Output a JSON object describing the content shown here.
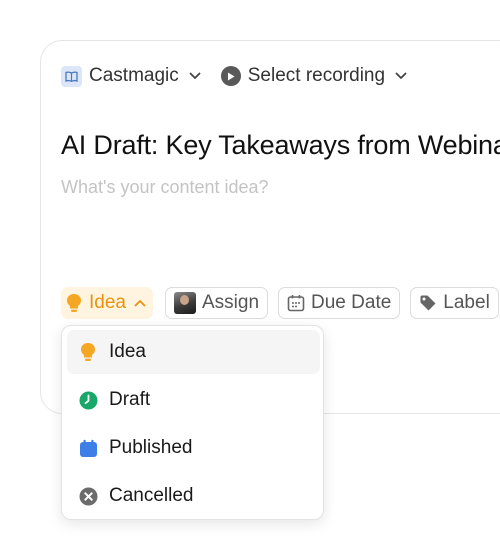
{
  "header": {
    "workspace_label": "Castmagic",
    "recording_label": "Select recording"
  },
  "editor": {
    "title": "AI Draft: Key Takeaways from Webina",
    "placeholder": "What's your content idea?"
  },
  "chips": {
    "status_label": "Idea",
    "assign_label": "Assign",
    "due_date_label": "Due Date",
    "label_label": "Label"
  },
  "status_menu": {
    "items": [
      {
        "label": "Idea",
        "icon": "bulb-icon",
        "color": "#f5a623"
      },
      {
        "label": "Draft",
        "icon": "clock-icon",
        "color": "#1aa86a"
      },
      {
        "label": "Published",
        "icon": "calendar-icon",
        "color": "#3d7fe6"
      },
      {
        "label": "Cancelled",
        "icon": "cancel-icon",
        "color": "#6b6b6b"
      }
    ],
    "selected": "Idea"
  },
  "colors": {
    "idea": "#f5a623",
    "idea_bg": "#fff4e0",
    "draft": "#1aa86a",
    "published": "#3d7fe6",
    "cancelled": "#6b6b6b"
  }
}
